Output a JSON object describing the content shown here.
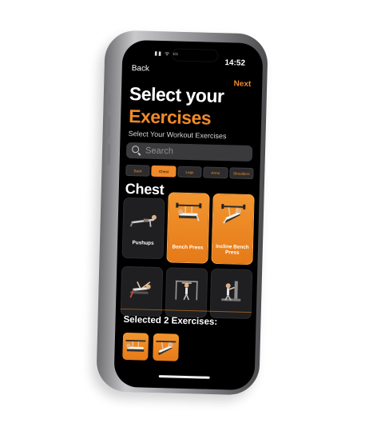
{
  "status": {
    "time": "14:52"
  },
  "nav": {
    "back_label": "Back",
    "next_label": "Next"
  },
  "title": {
    "line1": "Select your",
    "line2": "Exercises"
  },
  "subtitle": "Select Your Workout Exercises",
  "search": {
    "placeholder": "Search",
    "value": ""
  },
  "tabs": [
    {
      "label": "Back",
      "active": false
    },
    {
      "label": "Chest",
      "active": true
    },
    {
      "label": "Legs",
      "active": false
    },
    {
      "label": "Arms",
      "active": false
    },
    {
      "label": "Shoulders",
      "active": false
    }
  ],
  "section_title": "Chest",
  "exercises": [
    {
      "label": "Pushups",
      "selected": false,
      "icon": "pushup-figure-icon"
    },
    {
      "label": "Bench Press",
      "selected": true,
      "icon": "bench-press-figure-icon"
    },
    {
      "label": "Incline Bench Press",
      "selected": true,
      "icon": "incline-bench-figure-icon"
    },
    {
      "label": "",
      "selected": false,
      "icon": "cable-fly-figure-icon"
    },
    {
      "label": "",
      "selected": false,
      "icon": "dip-station-figure-icon"
    },
    {
      "label": "",
      "selected": false,
      "icon": "chest-machine-figure-icon"
    }
  ],
  "selected_summary": "Selected 2 Exercises:",
  "colors": {
    "accent": "#f08a2a",
    "background": "#000000",
    "card": "#1f1f21"
  }
}
